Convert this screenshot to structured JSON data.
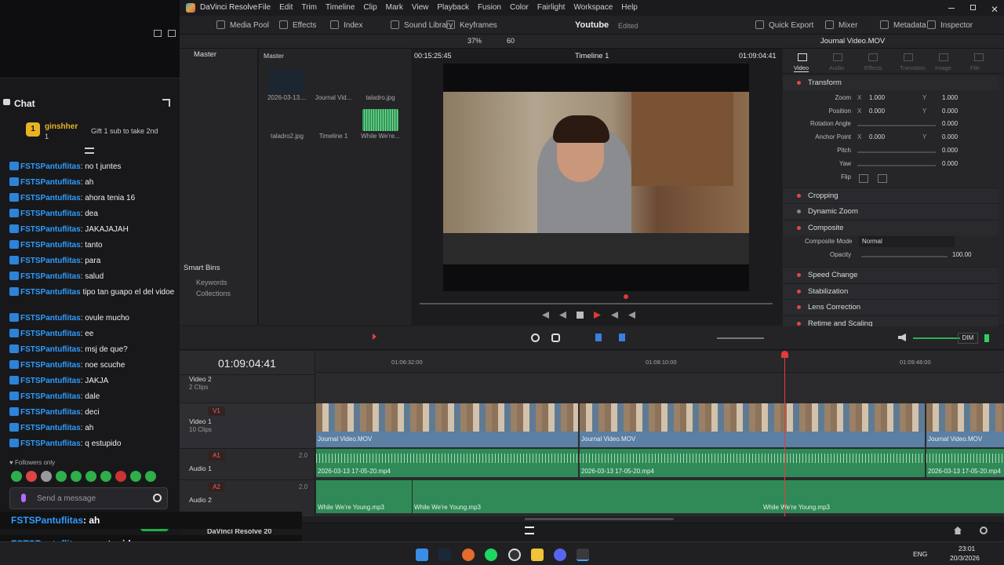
{
  "chat": {
    "title": "Chat",
    "pinned_user": "ginshher",
    "pinned_badge": "1",
    "pinned_count": "1",
    "pinned_text": "Gift 1 sub to take 2nd",
    "messages": [
      {
        "user": "FSTSPantuflitas",
        "text": ": no t juntes"
      },
      {
        "user": "FSTSPantuflitas",
        "text": ": ah"
      },
      {
        "user": "FSTSPantuflitas",
        "text": ": ahora tenia 16"
      },
      {
        "user": "FSTSPantuflitas",
        "text": ": dea"
      },
      {
        "user": "FSTSPantuflitas",
        "text": ": JAKAJAJAH"
      },
      {
        "user": "FSTSPantuflitas",
        "text": ": tanto"
      },
      {
        "user": "FSTSPantuflitas",
        "text": ": para"
      },
      {
        "user": "FSTSPantuflitas",
        "text": ": salud"
      },
      {
        "user": "FSTSPantuflitas",
        "text": " tipo tan guapo el del vidoe"
      },
      {
        "user": "FSTSPantuflitas",
        "text": ": ovule mucho"
      },
      {
        "user": "FSTSPantuflitas",
        "text": ": ee"
      },
      {
        "user": "FSTSPantuflitas",
        "text": ": msj de que?"
      },
      {
        "user": "FSTSPantuflitas",
        "text": ": noe scuche"
      },
      {
        "user": "FSTSPantuflitas",
        "text": ": JAKJA"
      },
      {
        "user": "FSTSPantuflitas",
        "text": ": dale"
      },
      {
        "user": "FSTSPantuflitas",
        "text": ": deci"
      },
      {
        "user": "FSTSPantuflitas",
        "text": ": ah"
      },
      {
        "user": "FSTSPantuflitas",
        "text": ": q estupido"
      }
    ],
    "followers_only": "Followers only",
    "input_placeholder": "Send a message",
    "send_label": "Chat",
    "overlay1_user": "FSTSPantuflitas",
    "overlay1_text": ": ah",
    "overlay2_user": "FSTSPantuflitas",
    "overlay2_text": ": q estupido"
  },
  "resolve": {
    "app": "DaVinci Resolve",
    "menu": [
      "File",
      "Edit",
      "Trim",
      "Timeline",
      "Clip",
      "Mark",
      "View",
      "Playback",
      "Fusion",
      "Color",
      "Fairlight",
      "Workspace",
      "Help"
    ],
    "toolbar_left": [
      "Media Pool",
      "Effects",
      "Index",
      "Sound Library",
      "Keyframes"
    ],
    "project": "Youtube",
    "project_status": "Edited",
    "toolbar_right": [
      "Quick Export",
      "Mixer",
      "Metadata",
      "Inspector"
    ],
    "zoom": "37%",
    "fps_val": "60",
    "src_tc": "00:15:25:45",
    "timeline_name": "Timeline 1",
    "rec_tc": "01:09:04:41",
    "clip_name": "Journal Video.MOV",
    "bins": {
      "master": "Master",
      "smart": "Smart Bins",
      "keywords": "Keywords",
      "collections": "Collections"
    },
    "pool_header": "Master",
    "media": [
      {
        "label": "2026-03-13...."
      },
      {
        "label": "Journal Vid..."
      },
      {
        "label": "taladro.jpg"
      },
      {
        "label": "taladro2.jpg"
      },
      {
        "label": "Timeline 1"
      },
      {
        "label": "While We're..."
      }
    ],
    "insp_tabs": [
      "Video",
      "Audio",
      "Effects",
      "Transition",
      "Image",
      "File"
    ],
    "transform": "Transform",
    "zoom_lbl": "Zoom",
    "zoom_x": "1.000",
    "zoom_y": "1.000",
    "pos_lbl": "Position",
    "pos_x": "0.000",
    "pos_y": "0.000",
    "rot_lbl": "Rotation Angle",
    "rot": "0.000",
    "anc_lbl": "Anchor Point",
    "anc_x": "0.000",
    "anc_y": "0.000",
    "pitch_lbl": "Pitch",
    "pitch": "0.000",
    "yaw_lbl": "Yaw",
    "yaw": "0.000",
    "flip_lbl": "Flip",
    "x": "X",
    "y": "Y",
    "sections": [
      "Cropping",
      "Dynamic Zoom",
      "Composite"
    ],
    "comp_mode_lbl": "Composite Mode",
    "comp_mode": "Normal",
    "opacity_lbl": "Opacity",
    "opacity": "100.00",
    "sections2": [
      "Speed Change",
      "Stabilization",
      "Lens Correction",
      "Retime and Scaling"
    ],
    "tl_tc": "01:09:04:41",
    "ruler": [
      "01:06:32:00",
      "01:08:10:00",
      "01:09:48:00"
    ],
    "dim": "DIM",
    "tracks": {
      "v2": {
        "name": "Video 2",
        "sub": "2 Clips"
      },
      "v1": {
        "id": "V1",
        "name": "Video 1",
        "sub": "10 Clips"
      },
      "a1": {
        "id": "A1",
        "name": "Audio 1",
        "vol": "2.0"
      },
      "a2": {
        "id": "A2",
        "name": "Audio 2",
        "vol": "2.0"
      }
    },
    "vclips": [
      "Journal Video.MOV",
      "Journal Video.MOV",
      "Journal Video.MOV"
    ],
    "a1clips": [
      "2026-03-13 17-05-20.mp4",
      "2026-03-13 17-05-20.mp4",
      "2026-03-13 17-05-20.mp4"
    ],
    "a2clips": [
      "While We're Young.mp3",
      "While We're Young.mp3",
      "While We're Young.mp3"
    ],
    "brand": "DaVinci Resolve 20"
  },
  "taskbar": {
    "lang": "ENG",
    "time": "23:01",
    "date": "20/3/2026"
  }
}
